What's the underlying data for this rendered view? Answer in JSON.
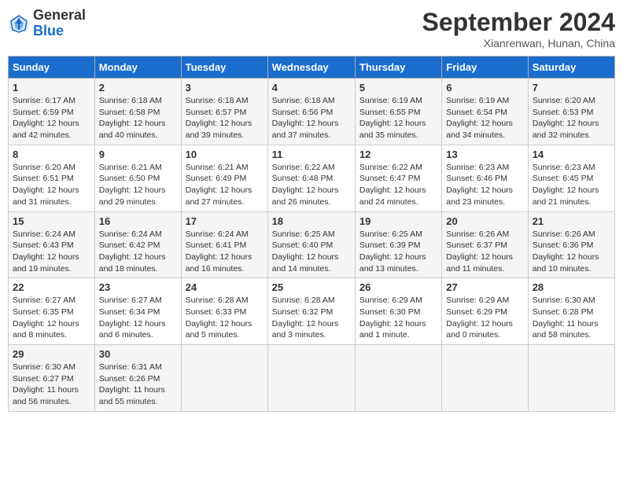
{
  "header": {
    "logo_general": "General",
    "logo_blue": "Blue",
    "month_title": "September 2024",
    "location": "Xianrenwan, Hunan, China"
  },
  "weekdays": [
    "Sunday",
    "Monday",
    "Tuesday",
    "Wednesday",
    "Thursday",
    "Friday",
    "Saturday"
  ],
  "weeks": [
    [
      {
        "day": "1",
        "info": "Sunrise: 6:17 AM\nSunset: 6:59 PM\nDaylight: 12 hours\nand 42 minutes."
      },
      {
        "day": "2",
        "info": "Sunrise: 6:18 AM\nSunset: 6:58 PM\nDaylight: 12 hours\nand 40 minutes."
      },
      {
        "day": "3",
        "info": "Sunrise: 6:18 AM\nSunset: 6:57 PM\nDaylight: 12 hours\nand 39 minutes."
      },
      {
        "day": "4",
        "info": "Sunrise: 6:18 AM\nSunset: 6:56 PM\nDaylight: 12 hours\nand 37 minutes."
      },
      {
        "day": "5",
        "info": "Sunrise: 6:19 AM\nSunset: 6:55 PM\nDaylight: 12 hours\nand 35 minutes."
      },
      {
        "day": "6",
        "info": "Sunrise: 6:19 AM\nSunset: 6:54 PM\nDaylight: 12 hours\nand 34 minutes."
      },
      {
        "day": "7",
        "info": "Sunrise: 6:20 AM\nSunset: 6:53 PM\nDaylight: 12 hours\nand 32 minutes."
      }
    ],
    [
      {
        "day": "8",
        "info": "Sunrise: 6:20 AM\nSunset: 6:51 PM\nDaylight: 12 hours\nand 31 minutes."
      },
      {
        "day": "9",
        "info": "Sunrise: 6:21 AM\nSunset: 6:50 PM\nDaylight: 12 hours\nand 29 minutes."
      },
      {
        "day": "10",
        "info": "Sunrise: 6:21 AM\nSunset: 6:49 PM\nDaylight: 12 hours\nand 27 minutes."
      },
      {
        "day": "11",
        "info": "Sunrise: 6:22 AM\nSunset: 6:48 PM\nDaylight: 12 hours\nand 26 minutes."
      },
      {
        "day": "12",
        "info": "Sunrise: 6:22 AM\nSunset: 6:47 PM\nDaylight: 12 hours\nand 24 minutes."
      },
      {
        "day": "13",
        "info": "Sunrise: 6:23 AM\nSunset: 6:46 PM\nDaylight: 12 hours\nand 23 minutes."
      },
      {
        "day": "14",
        "info": "Sunrise: 6:23 AM\nSunset: 6:45 PM\nDaylight: 12 hours\nand 21 minutes."
      }
    ],
    [
      {
        "day": "15",
        "info": "Sunrise: 6:24 AM\nSunset: 6:43 PM\nDaylight: 12 hours\nand 19 minutes."
      },
      {
        "day": "16",
        "info": "Sunrise: 6:24 AM\nSunset: 6:42 PM\nDaylight: 12 hours\nand 18 minutes."
      },
      {
        "day": "17",
        "info": "Sunrise: 6:24 AM\nSunset: 6:41 PM\nDaylight: 12 hours\nand 16 minutes."
      },
      {
        "day": "18",
        "info": "Sunrise: 6:25 AM\nSunset: 6:40 PM\nDaylight: 12 hours\nand 14 minutes."
      },
      {
        "day": "19",
        "info": "Sunrise: 6:25 AM\nSunset: 6:39 PM\nDaylight: 12 hours\nand 13 minutes."
      },
      {
        "day": "20",
        "info": "Sunrise: 6:26 AM\nSunset: 6:37 PM\nDaylight: 12 hours\nand 11 minutes."
      },
      {
        "day": "21",
        "info": "Sunrise: 6:26 AM\nSunset: 6:36 PM\nDaylight: 12 hours\nand 10 minutes."
      }
    ],
    [
      {
        "day": "22",
        "info": "Sunrise: 6:27 AM\nSunset: 6:35 PM\nDaylight: 12 hours\nand 8 minutes."
      },
      {
        "day": "23",
        "info": "Sunrise: 6:27 AM\nSunset: 6:34 PM\nDaylight: 12 hours\nand 6 minutes."
      },
      {
        "day": "24",
        "info": "Sunrise: 6:28 AM\nSunset: 6:33 PM\nDaylight: 12 hours\nand 5 minutes."
      },
      {
        "day": "25",
        "info": "Sunrise: 6:28 AM\nSunset: 6:32 PM\nDaylight: 12 hours\nand 3 minutes."
      },
      {
        "day": "26",
        "info": "Sunrise: 6:29 AM\nSunset: 6:30 PM\nDaylight: 12 hours\nand 1 minute."
      },
      {
        "day": "27",
        "info": "Sunrise: 6:29 AM\nSunset: 6:29 PM\nDaylight: 12 hours\nand 0 minutes."
      },
      {
        "day": "28",
        "info": "Sunrise: 6:30 AM\nSunset: 6:28 PM\nDaylight: 11 hours\nand 58 minutes."
      }
    ],
    [
      {
        "day": "29",
        "info": "Sunrise: 6:30 AM\nSunset: 6:27 PM\nDaylight: 11 hours\nand 56 minutes."
      },
      {
        "day": "30",
        "info": "Sunrise: 6:31 AM\nSunset: 6:26 PM\nDaylight: 11 hours\nand 55 minutes."
      },
      {
        "day": "",
        "info": ""
      },
      {
        "day": "",
        "info": ""
      },
      {
        "day": "",
        "info": ""
      },
      {
        "day": "",
        "info": ""
      },
      {
        "day": "",
        "info": ""
      }
    ]
  ]
}
